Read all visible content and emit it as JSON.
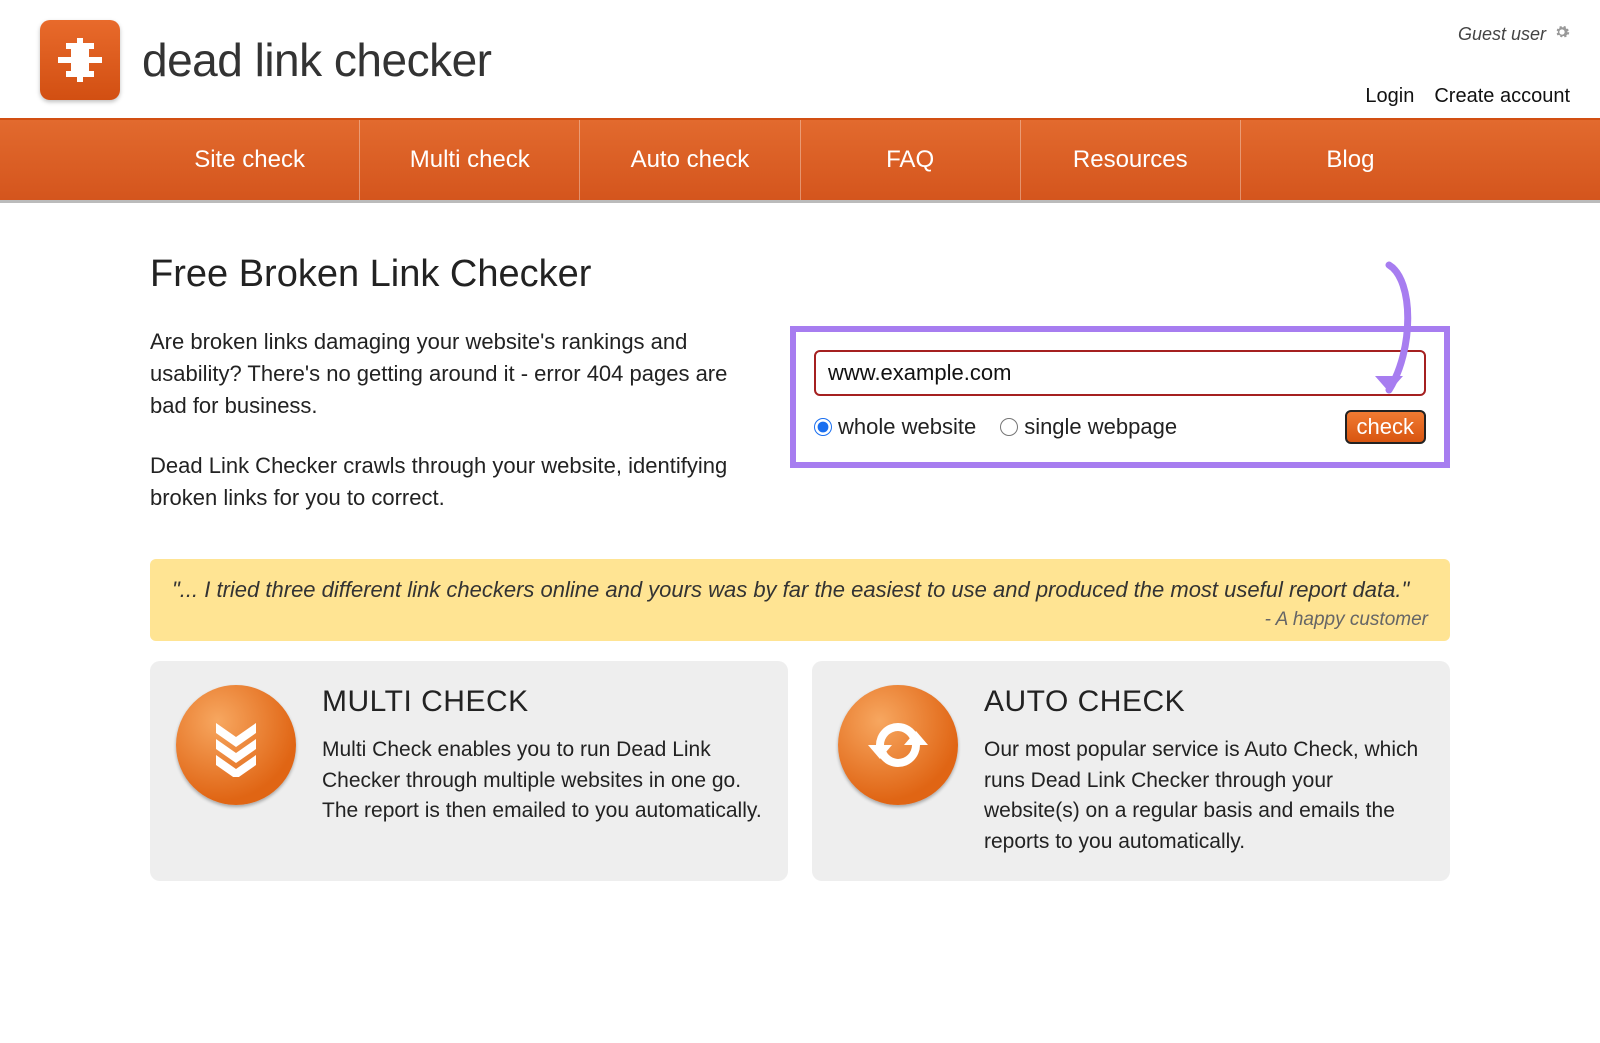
{
  "header": {
    "site_title": "dead link checker",
    "guest_label": "Guest user",
    "login": "Login",
    "create_account": "Create account"
  },
  "nav": {
    "items": [
      "Site check",
      "Multi check",
      "Auto check",
      "FAQ",
      "Resources",
      "Blog"
    ]
  },
  "main": {
    "title": "Free Broken Link Checker",
    "para1": "Are broken links damaging your website's rankings and usability? There's no getting around it - error 404 pages are bad for business.",
    "para2": "Dead Link Checker crawls through your website, identifying broken links for you to correct."
  },
  "check_form": {
    "url_value": "www.example.com",
    "radio_whole": "whole website",
    "radio_single": "single webpage",
    "selected": "whole",
    "button": "check"
  },
  "testimonial": {
    "quote": "\"... I tried three different link checkers online and yours was by far the easiest to use and produced the most useful report data.\"",
    "attrib": "- A happy customer"
  },
  "cards": {
    "multi": {
      "title": "MULTI CHECK",
      "body": "Multi Check enables you to run Dead Link Checker through multiple websites in one go. The report is then emailed to you automatically."
    },
    "auto": {
      "title": "AUTO CHECK",
      "body": "Our most popular service is Auto Check, which runs Dead Link Checker through your website(s) on a regular basis and emails the reports to you automatically."
    }
  }
}
